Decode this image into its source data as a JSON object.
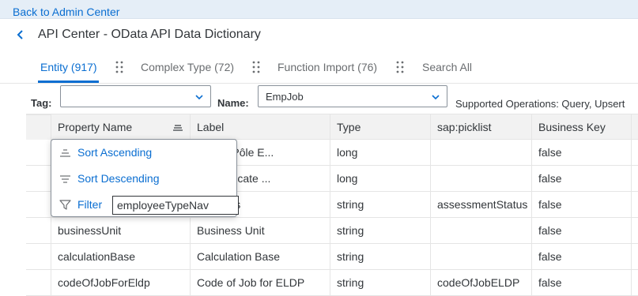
{
  "header": {
    "back_link": "Back to Admin Center",
    "title": "API Center - OData API Data Dictionary"
  },
  "tabs": [
    {
      "label": "Entity (917)",
      "active": true
    },
    {
      "label": "Complex Type (72)",
      "active": false
    },
    {
      "label": "Function Import (76)",
      "active": false
    },
    {
      "label": "Search All",
      "active": false
    }
  ],
  "toolbar": {
    "tag_label": "Tag:",
    "tag_value": "",
    "name_label": "Name:",
    "name_value": "EmpJob",
    "ops_text": "Supported Operations: Query, Upsert"
  },
  "table": {
    "columns": [
      "Property Name",
      "Label",
      "Type",
      "sap:picklist",
      "Business Key"
    ],
    "rows": [
      [
        "",
        "f Initial Pôle E...",
        "long",
        "",
        "false"
      ],
      [
        "",
        "oi Certificate ...",
        "long",
        "",
        "false"
      ],
      [
        "",
        "nt Status",
        "string",
        "assessmentStatus",
        "false"
      ],
      [
        "businessUnit",
        "Business Unit",
        "string",
        "",
        "false"
      ],
      [
        "calculationBase",
        "Calculation Base",
        "string",
        "",
        "false"
      ],
      [
        "codeOfJobForEldp",
        "Code of Job for ELDP",
        "string",
        "codeOfJobELDP",
        "false"
      ]
    ]
  },
  "column_menu": {
    "sort_ascending": "Sort Ascending",
    "sort_descending": "Sort Descending",
    "filter_label": "Filter",
    "filter_value": "employeeTypeNav"
  },
  "colors": {
    "accent": "#0a6ed1",
    "text": "#32363a",
    "header_bg": "#f2f2f2",
    "topbar_bg": "#e5eef7"
  }
}
